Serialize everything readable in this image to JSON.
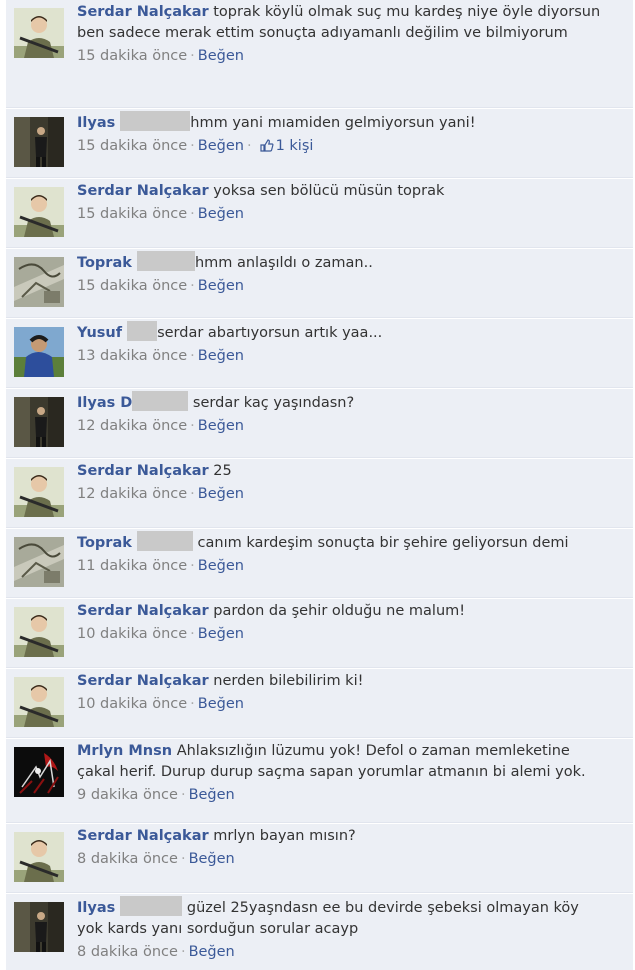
{
  "comments": [
    {
      "author": "Serdar Nalçakar",
      "redacted": false,
      "text": " toprak köylü olmak suç mu kardeş niye öyle diyorsun ben sadece merak ettim sonuçta adıyamanlı değilim ve bilmiyorum",
      "time": "15 dakika önce",
      "sep": "·",
      "like": "Beğen",
      "likes": "",
      "avatar": "serdar"
    },
    {
      "author": "Ilyas ",
      "redacted": true,
      "text": "hmm yani mıamiden gelmiyorsun yani!",
      "time": "15 dakika önce",
      "sep": "·",
      "like": "Beğen",
      "likes": "1 kişi",
      "avatar": "ilyas"
    },
    {
      "author": "Serdar Nalçakar",
      "redacted": false,
      "text": " yoksa sen bölücü müsün toprak",
      "time": "15 dakika önce",
      "sep": "·",
      "like": "Beğen",
      "likes": "",
      "avatar": "serdar"
    },
    {
      "author": "Toprak ",
      "redacted": true,
      "text": "hmm anlaşıldı o zaman..",
      "time": "15 dakika önce",
      "sep": "·",
      "like": "Beğen",
      "likes": "",
      "avatar": "toprak"
    },
    {
      "author": "Yusuf ",
      "redacted": true,
      "text": "serdar abartıyorsun artık yaa...",
      "time": "13 dakika önce",
      "sep": "·",
      "like": "Beğen",
      "likes": "",
      "avatar": "yusuf"
    },
    {
      "author": "Ilyas D",
      "redacted": true,
      "text": " serdar kaç yaşındasn?",
      "time": "12 dakika önce",
      "sep": "·",
      "like": "Beğen",
      "likes": "",
      "avatar": "ilyas"
    },
    {
      "author": "Serdar Nalçakar",
      "redacted": false,
      "text": " 25",
      "time": "12 dakika önce",
      "sep": "·",
      "like": "Beğen",
      "likes": "",
      "avatar": "serdar"
    },
    {
      "author": "Toprak ",
      "redacted": true,
      "text": " canım kardeşim sonuçta bir şehire geliyorsun demi",
      "time": "11 dakika önce",
      "sep": "·",
      "like": "Beğen",
      "likes": "",
      "avatar": "toprak"
    },
    {
      "author": "Serdar Nalçakar",
      "redacted": false,
      "text": " pardon da şehir olduğu ne malum!",
      "time": "10 dakika önce",
      "sep": "·",
      "like": "Beğen",
      "likes": "",
      "avatar": "serdar"
    },
    {
      "author": "Serdar Nalçakar",
      "redacted": false,
      "text": " nerden bilebilirim ki!",
      "time": "10 dakika önce",
      "sep": "·",
      "like": "Beğen",
      "likes": "",
      "avatar": "serdar"
    },
    {
      "author": "Mrlyn Mnsn",
      "redacted": false,
      "text": " Ahlaksızlığın lüzumu yok! Defol o zaman memleketine çakal herif. Durup durup saçma sapan yorumlar atmanın bi alemi yok.",
      "time": "9 dakika önce",
      "sep": "·",
      "like": "Beğen",
      "likes": "",
      "avatar": "mrlyn"
    },
    {
      "author": "Serdar Nalçakar",
      "redacted": false,
      "text": " mrlyn bayan mısın?",
      "time": "8 dakika önce",
      "sep": "·",
      "like": "Beğen",
      "likes": "",
      "avatar": "serdar"
    },
    {
      "author": "Ilyas ",
      "redacted": true,
      "text": " güzel 25yaşndasn ee bu devirde şebeksi olmayan köy yok kards yanı sorduğun sorular acayp",
      "time": "8 dakika önce",
      "sep": "·",
      "like": "Beğen",
      "likes": "",
      "avatar": "ilyas"
    }
  ],
  "colors": {
    "author_link": "#3b5998",
    "comment_bg": "#eceff5",
    "meta_text": "#808080",
    "redaction": "#c9c9c9"
  },
  "icons": {
    "like": "thumbs-up-icon"
  }
}
